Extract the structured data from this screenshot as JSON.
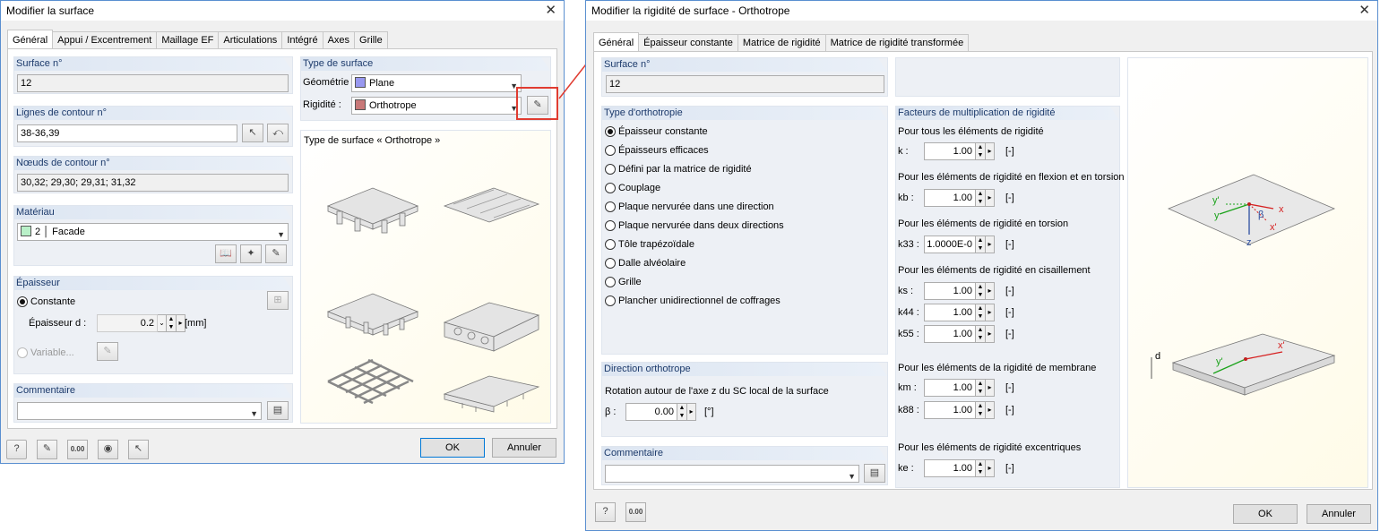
{
  "dlg1": {
    "title": "Modifier la surface",
    "tabs": [
      "Général",
      "Appui / Excentrement",
      "Maillage EF",
      "Articulations",
      "Intégré",
      "Axes",
      "Grille"
    ],
    "surface_no": {
      "label": "Surface n°",
      "value": "12"
    },
    "contour_lines": {
      "label": "Lignes de contour n°",
      "value": "38-36,39"
    },
    "contour_nodes": {
      "label": "Nœuds de contour n°",
      "value": "30,32; 29,30; 29,31; 31,32"
    },
    "material": {
      "label": "Matériau",
      "number": "2",
      "name": "Facade",
      "swatch": "#b9f0c8"
    },
    "thickness": {
      "label": "Épaisseur",
      "constant": "Constante",
      "thick_label": "Épaisseur d :",
      "thick_value": "0.2",
      "unit": "[mm]",
      "variable": "Variable..."
    },
    "comment": {
      "label": "Commentaire",
      "value": ""
    },
    "surface_type": {
      "label": "Type de surface",
      "geometry_label": "Géométrie :",
      "geometry": "Plane",
      "geometry_color": "#9898f0",
      "stiffness_label": "Rigidité :",
      "stiffness": "Orthotrope",
      "stiffness_color": "#c87878"
    },
    "preview_title": "Type de surface « Orthotrope »",
    "ok": "OK",
    "cancel": "Annuler",
    "footer_icon_text": "0.00"
  },
  "dlg2": {
    "title": "Modifier la rigidité de surface - Orthotrope",
    "tabs": [
      "Général",
      "Épaisseur constante",
      "Matrice de rigidité",
      "Matrice de rigidité transformée"
    ],
    "surface_no": {
      "label": "Surface n°",
      "value": "12"
    },
    "ortho_type": {
      "label": "Type d'orthotropie",
      "options": [
        "Épaisseur constante",
        "Épaisseurs efficaces",
        "Défini par la matrice de rigidité",
        "Couplage",
        "Plaque nervurée dans une direction",
        "Plaque nervurée dans deux directions",
        "Tôle trapézoïdale",
        "Dalle alvéolaire",
        "Grille",
        "Plancher unidirectionnel de coffrages"
      ],
      "selected": 0
    },
    "direction": {
      "label": "Direction orthotrope",
      "text": "Rotation autour de l'axe z du SC local de la surface",
      "beta_label": "β :",
      "beta_value": "0.00",
      "unit": "[°]"
    },
    "comment": {
      "label": "Commentaire",
      "value": ""
    },
    "factors": {
      "label": "Facteurs de multiplication de rigidité",
      "groups": [
        {
          "title": "Pour tous les éléments de rigidité",
          "rows": [
            {
              "sym": "k :",
              "val": "1.00",
              "unit": "[-]"
            }
          ]
        },
        {
          "title": "Pour les éléments de rigidité en flexion et en torsion",
          "rows": [
            {
              "sym": "kb :",
              "val": "1.00",
              "unit": "[-]"
            }
          ]
        },
        {
          "title": "Pour les éléments de rigidité en torsion",
          "rows": [
            {
              "sym": "k33 :",
              "val": "1.0000E-0",
              "unit": "[-]"
            }
          ]
        },
        {
          "title": "Pour les éléments de rigidité en cisaillement",
          "rows": [
            {
              "sym": "ks :",
              "val": "1.00",
              "unit": "[-]"
            },
            {
              "sym": "k44 :",
              "val": "1.00",
              "unit": "[-]"
            },
            {
              "sym": "k55 :",
              "val": "1.00",
              "unit": "[-]"
            }
          ]
        },
        {
          "title": "Pour les éléments de la rigidité de membrane",
          "rows": [
            {
              "sym": "km :",
              "val": "1.00",
              "unit": "[-]"
            },
            {
              "sym": "k88 :",
              "val": "1.00",
              "unit": "[-]"
            }
          ]
        },
        {
          "title": "Pour les éléments de rigidité excentriques",
          "rows": [
            {
              "sym": "ke :",
              "val": "1.00",
              "unit": "[-]"
            }
          ]
        }
      ]
    },
    "diagram": {
      "y1": "y'",
      "y": "y",
      "beta": "β",
      "x": "x",
      "x1": "x'",
      "z": "z",
      "d": "d",
      "y2": "y'",
      "x2": "x'"
    },
    "ok": "OK",
    "cancel": "Annuler",
    "footer_icon_text": "0.00"
  },
  "colors": {
    "highlight": "#e03c31",
    "accent": "#0078d7"
  }
}
